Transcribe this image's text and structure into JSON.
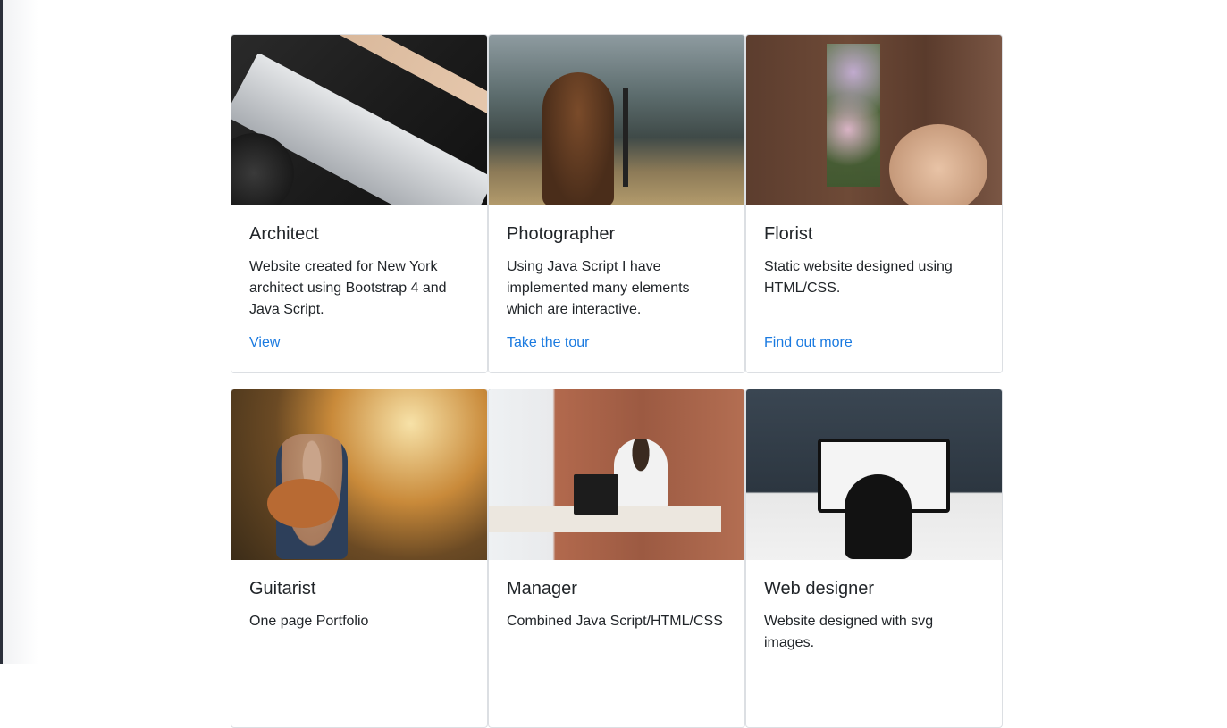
{
  "cards": [
    {
      "title": "Architect",
      "description": "Website created for New York architect using Bootstrap 4 and Java Script.",
      "link": "View",
      "image": "architect-tools-image"
    },
    {
      "title": "Photographer",
      "description": "Using Java Script I have implemented many elements which are interactive.",
      "link": "Take the tour",
      "image": "photographer-image"
    },
    {
      "title": "Florist",
      "description": "Static website designed using HTML/CSS.",
      "link": "Find out more",
      "image": "florist-table-image"
    },
    {
      "title": "Guitarist",
      "description": "One page Portfolio",
      "link": "",
      "image": "guitarist-image"
    },
    {
      "title": "Manager",
      "description": "Combined Java Script/HTML/CSS",
      "link": "",
      "image": "manager-desk-image"
    },
    {
      "title": "Web designer",
      "description": "Website designed with svg images.",
      "link": "",
      "image": "web-designer-image"
    }
  ],
  "colors": {
    "link": "#1a7ae0",
    "text": "#212529",
    "border": "#dcdfe3"
  }
}
